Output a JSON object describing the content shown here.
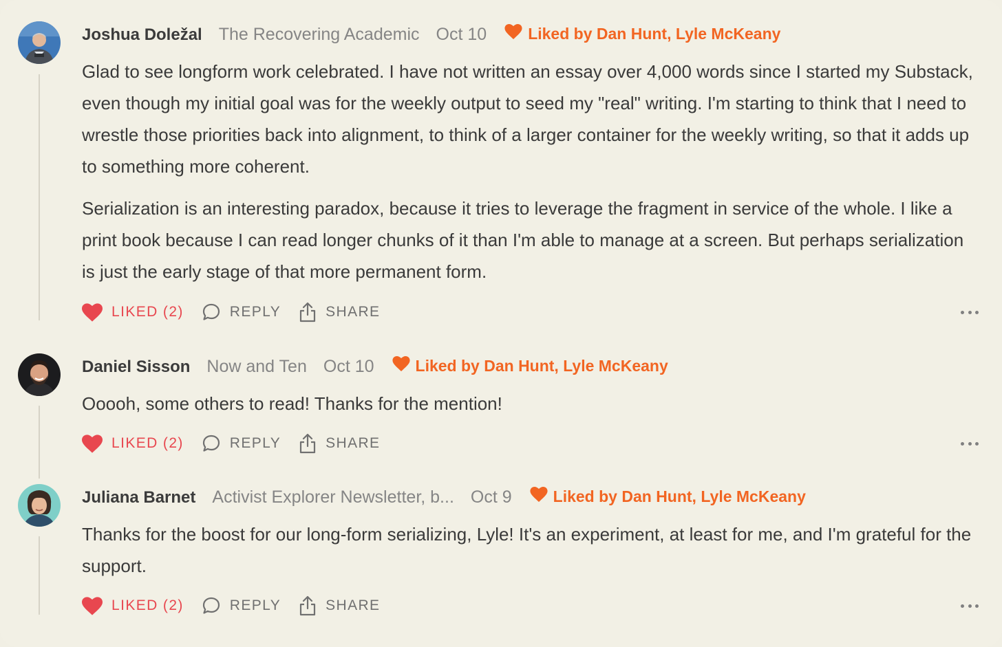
{
  "colors": {
    "background": "#f2f0e5",
    "accent_orange": "#f26522",
    "liked_red": "#e8474f",
    "muted_text": "#858585"
  },
  "action_labels": {
    "liked": "LIKED (2)",
    "reply": "REPLY",
    "share": "SHARE"
  },
  "comments": [
    {
      "author": "Joshua Doležal",
      "publication": "The Recovering Academic",
      "date": "Oct 10",
      "liked_by": "Liked by Dan Hunt, Lyle McKeany",
      "paragraphs": [
        "Glad to see longform work celebrated. I have not written an essay over 4,000 words since I started my Substack, even though my initial goal was for the weekly output to seed my \"real\" writing. I'm starting to think that I need to wrestle those priorities back into alignment, to think of a larger container for the weekly writing, so that it adds up to something more coherent.",
        "Serialization is an interesting paradox, because it tries to leverage the fragment in service of the whole. I like a print book because I can read longer chunks of it than I'm able to manage at a screen. But perhaps serialization is just the early stage of that more permanent form."
      ]
    },
    {
      "author": "Daniel Sisson",
      "publication": "Now and Ten",
      "date": "Oct 10",
      "liked_by": "Liked by Dan Hunt, Lyle McKeany",
      "paragraphs": [
        "Ooooh, some others to read! Thanks for the mention!"
      ]
    },
    {
      "author": "Juliana Barnet",
      "publication": "Activist Explorer Newsletter, b...",
      "date": "Oct 9",
      "liked_by": "Liked by Dan Hunt, Lyle McKeany",
      "paragraphs": [
        "Thanks for the boost for our long-form serializing, Lyle! It's an experiment, at least for me, and I'm grateful for the support."
      ]
    }
  ]
}
